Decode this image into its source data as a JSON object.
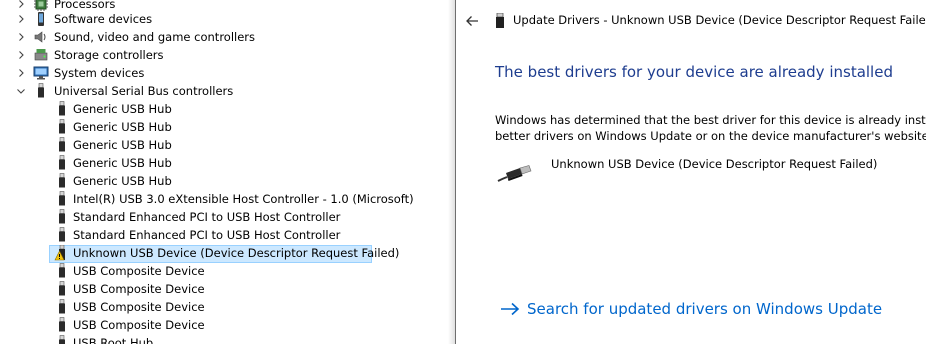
{
  "tree": {
    "items": [
      {
        "label": "Processors",
        "level": 1,
        "expander": "collapsed",
        "icon": "processor-icon"
      },
      {
        "label": "Software devices",
        "level": 1,
        "expander": "collapsed",
        "icon": "software-device-icon"
      },
      {
        "label": "Sound, video and game controllers",
        "level": 1,
        "expander": "collapsed",
        "icon": "speaker-icon"
      },
      {
        "label": "Storage controllers",
        "level": 1,
        "expander": "collapsed",
        "icon": "storage-controller-icon"
      },
      {
        "label": "System devices",
        "level": 1,
        "expander": "collapsed",
        "icon": "system-device-icon"
      },
      {
        "label": "Universal Serial Bus controllers",
        "level": 1,
        "expander": "expanded",
        "icon": "usb-plug-icon"
      },
      {
        "label": "Generic USB Hub",
        "level": 2,
        "icon": "usb-plug-icon"
      },
      {
        "label": "Generic USB Hub",
        "level": 2,
        "icon": "usb-plug-icon"
      },
      {
        "label": "Generic USB Hub",
        "level": 2,
        "icon": "usb-plug-icon"
      },
      {
        "label": "Generic USB Hub",
        "level": 2,
        "icon": "usb-plug-icon"
      },
      {
        "label": "Generic USB Hub",
        "level": 2,
        "icon": "usb-plug-icon"
      },
      {
        "label": "Intel(R) USB 3.0 eXtensible Host Controller - 1.0 (Microsoft)",
        "level": 2,
        "icon": "usb-plug-icon"
      },
      {
        "label": "Standard Enhanced PCI to USB Host Controller",
        "level": 2,
        "icon": "usb-plug-icon"
      },
      {
        "label": "Standard Enhanced PCI to USB Host Controller",
        "level": 2,
        "icon": "usb-plug-icon"
      },
      {
        "label": "Unknown USB Device (Device Descriptor Request Failed)",
        "level": 2,
        "icon": "warning-icon",
        "selected": true
      },
      {
        "label": "USB Composite Device",
        "level": 2,
        "icon": "usb-plug-icon"
      },
      {
        "label": "USB Composite Device",
        "level": 2,
        "icon": "usb-plug-icon"
      },
      {
        "label": "USB Composite Device",
        "level": 2,
        "icon": "usb-plug-icon"
      },
      {
        "label": "USB Composite Device",
        "level": 2,
        "icon": "usb-plug-icon"
      },
      {
        "label": "USB Root Hub",
        "level": 2,
        "icon": "usb-plug-icon"
      }
    ]
  },
  "dialog": {
    "title": "Update Drivers - Unknown USB Device (Device Descriptor Request Failed)",
    "heading": "The best drivers for your device are already installed",
    "paragraph_line1": "Windows has determined that the best driver for this device is already installed. Th",
    "paragraph_line2": "better drivers on Windows Update or on the device manufacturer's website.",
    "device_name": "Unknown USB Device (Device Descriptor Request Failed)",
    "link_label": "Search for updated drivers on Windows Update",
    "back_icon": "back-arrow-icon",
    "link_icon": "right-arrow-icon"
  },
  "colors": {
    "heading": "#1e3d8f",
    "link": "#0066cc",
    "selection_bg": "#cce8ff",
    "selection_border": "#99d1ff"
  }
}
